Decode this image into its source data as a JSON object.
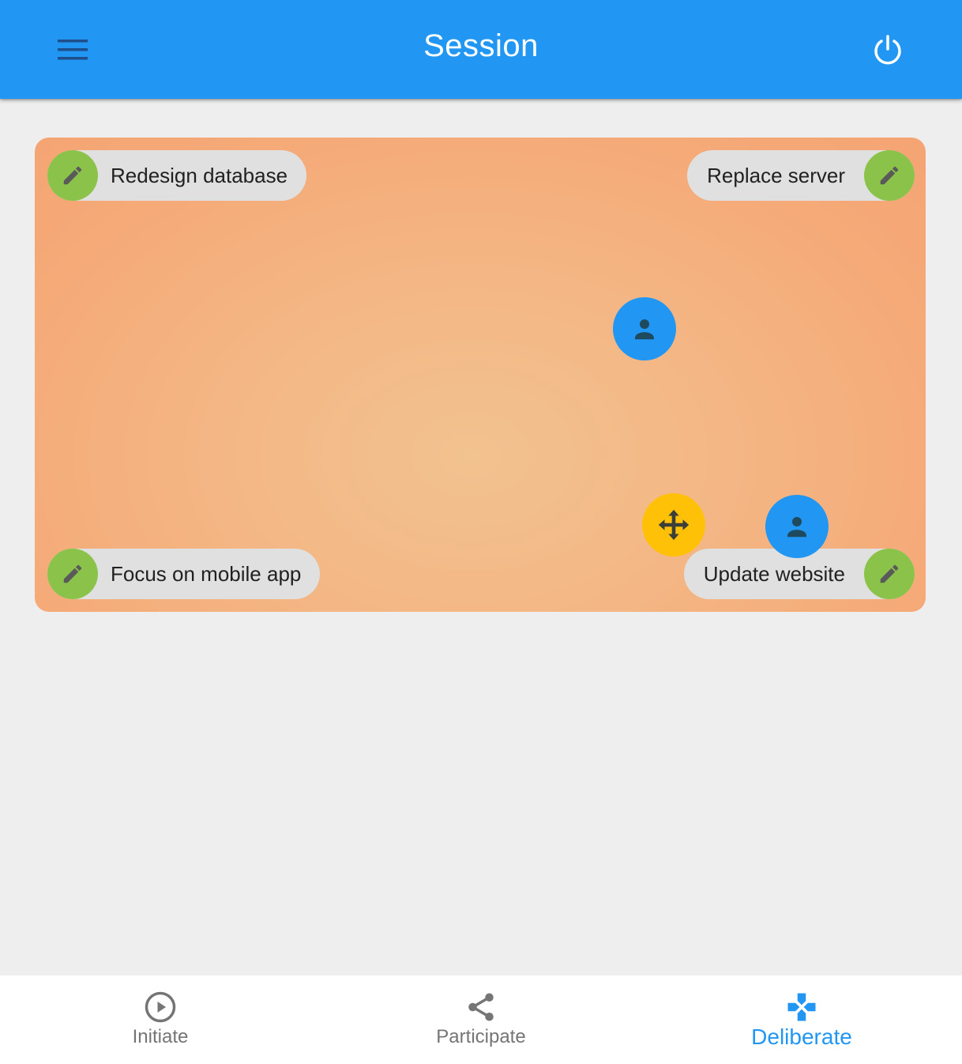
{
  "appbar": {
    "title": "Session",
    "menu_icon": "menu-icon",
    "power_icon": "power-icon",
    "color": "#2196f3"
  },
  "board": {
    "chips": [
      {
        "label": "Redesign database",
        "icon": "pencil-icon"
      },
      {
        "label": "Replace server",
        "icon": "pencil-icon"
      },
      {
        "label": "Focus on mobile app",
        "icon": "pencil-icon"
      },
      {
        "label": "Update website",
        "icon": "pencil-icon"
      }
    ],
    "chip_icon_color": "#8bc34a",
    "avatar_icon": "person-icon",
    "avatar_color": "#2196f3",
    "move_handle_icon": "move-arrows-icon",
    "move_handle_color": "#ffc107"
  },
  "bottom_nav": {
    "items": [
      {
        "label": "Initiate",
        "icon": "play-circle-icon",
        "active": false
      },
      {
        "label": "Participate",
        "icon": "share-icon",
        "active": false
      },
      {
        "label": "Deliberate",
        "icon": "deliberate-icon",
        "active": true
      }
    ],
    "active_color": "#2196f3",
    "inactive_color": "#757575"
  }
}
